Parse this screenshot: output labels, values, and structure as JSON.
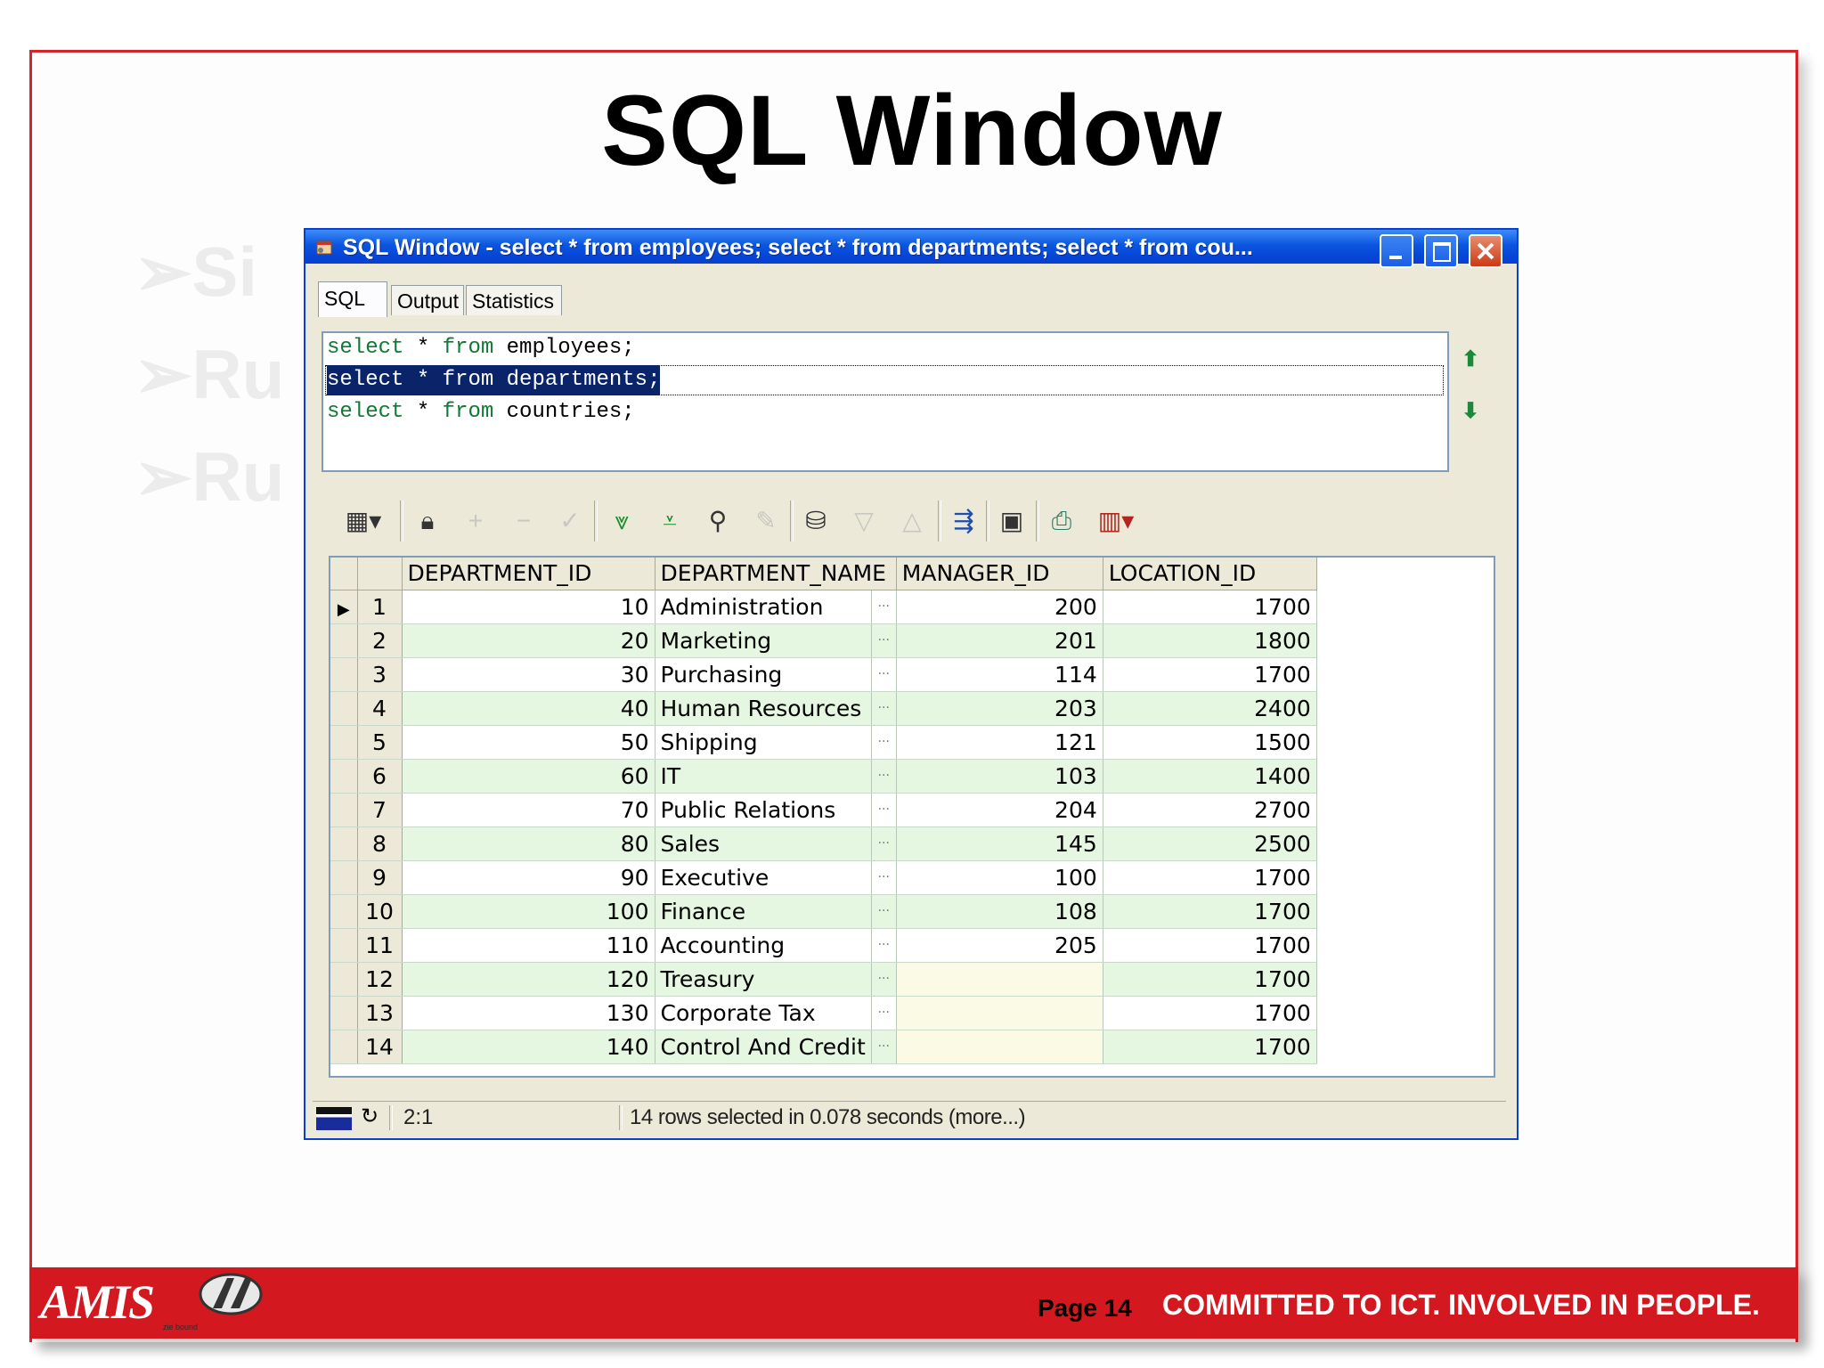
{
  "slide": {
    "title": "SQL Window",
    "bg_bullets": [
      "➢Si",
      "➢Ru",
      "➢Ru"
    ]
  },
  "window": {
    "title": "SQL Window - select * from employees; select * from departments; select * from cou...",
    "tabs": [
      "SQL",
      "Output",
      "Statistics"
    ],
    "sql_lines": [
      {
        "kw": "select",
        "star": " * ",
        "from": "from",
        "table": " employees;"
      },
      {
        "kw": "select",
        "star": " * ",
        "from": "from",
        "table": " departments;"
      },
      {
        "kw": "select",
        "star": " * ",
        "from": "from",
        "table": " countries;"
      }
    ],
    "toolbar_icons": [
      "grid-options-icon",
      "lock-icon",
      "insert-record-icon",
      "delete-record-icon",
      "post-changes-icon",
      "fetch-next-icon",
      "fetch-last-icon",
      "find-icon",
      "clear-record-icon",
      "query-by-example-icon",
      "previous-record-icon",
      "next-record-icon",
      "export-icon",
      "save-icon",
      "print-icon",
      "chart-icon"
    ]
  },
  "grid": {
    "columns": [
      "DEPARTMENT_ID",
      "DEPARTMENT_NAME",
      "MANAGER_ID",
      "LOCATION_ID"
    ],
    "rows": [
      {
        "n": "1",
        "id": "10",
        "name": "Administration",
        "mgr": "200",
        "loc": "1700"
      },
      {
        "n": "2",
        "id": "20",
        "name": "Marketing",
        "mgr": "201",
        "loc": "1800"
      },
      {
        "n": "3",
        "id": "30",
        "name": "Purchasing",
        "mgr": "114",
        "loc": "1700"
      },
      {
        "n": "4",
        "id": "40",
        "name": "Human Resources",
        "mgr": "203",
        "loc": "2400"
      },
      {
        "n": "5",
        "id": "50",
        "name": "Shipping",
        "mgr": "121",
        "loc": "1500"
      },
      {
        "n": "6",
        "id": "60",
        "name": "IT",
        "mgr": "103",
        "loc": "1400"
      },
      {
        "n": "7",
        "id": "70",
        "name": "Public Relations",
        "mgr": "204",
        "loc": "2700"
      },
      {
        "n": "8",
        "id": "80",
        "name": "Sales",
        "mgr": "145",
        "loc": "2500"
      },
      {
        "n": "9",
        "id": "90",
        "name": "Executive",
        "mgr": "100",
        "loc": "1700"
      },
      {
        "n": "10",
        "id": "100",
        "name": "Finance",
        "mgr": "108",
        "loc": "1700"
      },
      {
        "n": "11",
        "id": "110",
        "name": "Accounting",
        "mgr": "205",
        "loc": "1700"
      },
      {
        "n": "12",
        "id": "120",
        "name": "Treasury",
        "mgr": "",
        "loc": "1700"
      },
      {
        "n": "13",
        "id": "130",
        "name": "Corporate Tax",
        "mgr": "",
        "loc": "1700"
      },
      {
        "n": "14",
        "id": "140",
        "name": "Control And Credit",
        "mgr": "",
        "loc": "1700"
      }
    ],
    "dots": "···"
  },
  "status": {
    "position": "2:1",
    "message": "14 rows selected in 0.078 seconds (more...)"
  },
  "footer": {
    "logo": "AMIS",
    "logo_sub": "zie bound",
    "page": "Page 14",
    "slogan": "COMMITTED TO ICT.  INVOLVED IN PEOPLE."
  },
  "colors": {
    "brand_red": "#d3191f",
    "titlebar_blue": "#0545d6",
    "grid_stripe_green": "#e6f7e1",
    "sql_keyword_green": "#0f7a33",
    "selection_navy": "#0a246a"
  }
}
